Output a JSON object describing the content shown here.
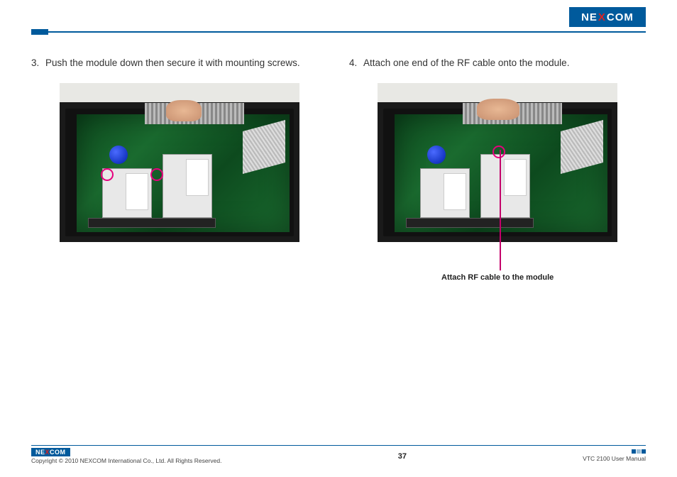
{
  "brand": {
    "name_left": "NE",
    "name_x": "X",
    "name_right": "COM"
  },
  "steps": {
    "left": {
      "num": "3.",
      "text": "Push the module down then secure it with mounting screws."
    },
    "right": {
      "num": "4.",
      "text": "Attach one end of the RF cable onto the module."
    }
  },
  "callout": {
    "text": "Attach RF cable to the module"
  },
  "footer": {
    "copyright": "Copyright © 2010 NEXCOM International Co., Ltd. All Rights Reserved.",
    "page": "37",
    "doc": "VTC 2100 User Manual"
  }
}
